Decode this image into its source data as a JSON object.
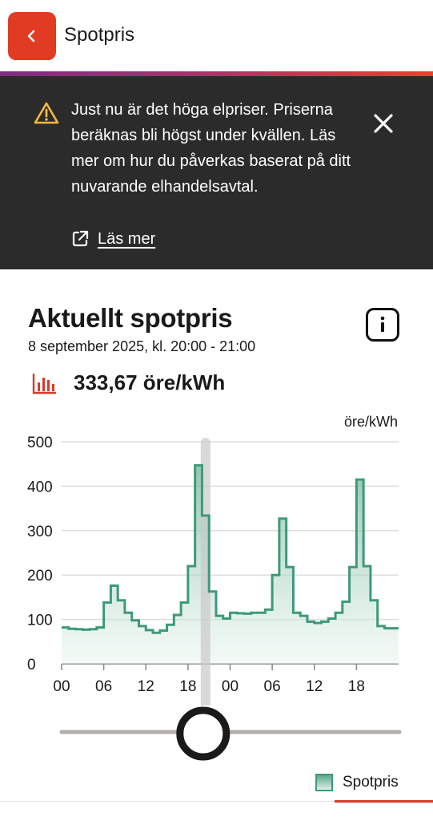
{
  "header": {
    "title": "Spotpris",
    "back_icon": "chevron-left-icon",
    "accent_color": "#e23b24"
  },
  "banner": {
    "message": "Just nu är det höga elpriser. Priserna beräknas bli högst under kvällen. Läs mer om hur du påverkas baserat på ditt nuvarande elhandelsavtal.",
    "link_label": "Läs mer",
    "warning_icon": "warning-triangle-icon",
    "close_icon": "close-icon",
    "link_icon": "external-link-icon",
    "background": "#2b2b2b",
    "warning_color": "#f5b841"
  },
  "spot": {
    "title": "Aktuellt spotpris",
    "date": "8 september 2025, kl. 20:00 - 21:00",
    "price": "333,67 öre/kWh",
    "price_icon": "bar-chart-icon",
    "info_icon": "info-icon"
  },
  "legend": {
    "label": "Spotpris"
  },
  "chart_data": {
    "type": "line",
    "step": true,
    "unit_label": "öre/kWh",
    "ylim": [
      0,
      500
    ],
    "y_ticks": [
      "0",
      "100",
      "200",
      "300",
      "400",
      "500"
    ],
    "x_ticks": [
      "00",
      "06",
      "12",
      "18",
      "00",
      "06",
      "12",
      "18"
    ],
    "grid": true,
    "fill": "gradient",
    "line_color": "#3d9a78",
    "highlight_hour": 20,
    "series": [
      {
        "name": "Spotpris",
        "values": [
          82,
          79,
          78,
          77,
          78,
          82,
          138,
          176,
          143,
          115,
          98,
          85,
          76,
          70,
          75,
          88,
          110,
          138,
          220,
          447,
          334,
          163,
          108,
          102,
          115,
          114,
          113,
          115,
          115,
          122,
          200,
          327,
          218,
          115,
          108,
          95,
          92,
          95,
          102,
          115,
          140,
          218,
          415,
          220,
          143,
          85,
          80,
          80
        ]
      }
    ]
  },
  "slider": {
    "value": 0.42
  }
}
